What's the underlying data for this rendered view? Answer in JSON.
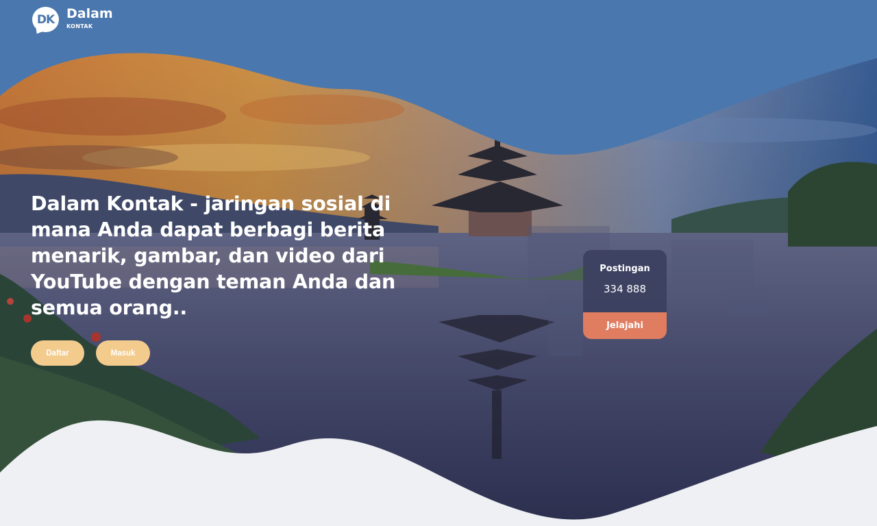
{
  "header": {
    "logo_initials": "DK",
    "brand_name": "Dalam",
    "brand_sub": "KONTAK"
  },
  "hero": {
    "headline": "Dalam Kontak - jaringan sosial di mana Anda dapat berbagi berita menarik, gambar, dan video dari YouTube dengan teman Anda dan semua orang..",
    "buttons": {
      "register_label": "Daftar",
      "login_label": "Masuk"
    }
  },
  "stats_card": {
    "title": "Postingan",
    "count": "334 888",
    "action_label": "Jelajahi"
  },
  "colors": {
    "sky_blue": "#4a77ad",
    "button_yellow": "#f3cb8d",
    "card_dark": "#3c4060",
    "card_orange": "#e07c5f",
    "wave_light": "#eef0f3"
  }
}
